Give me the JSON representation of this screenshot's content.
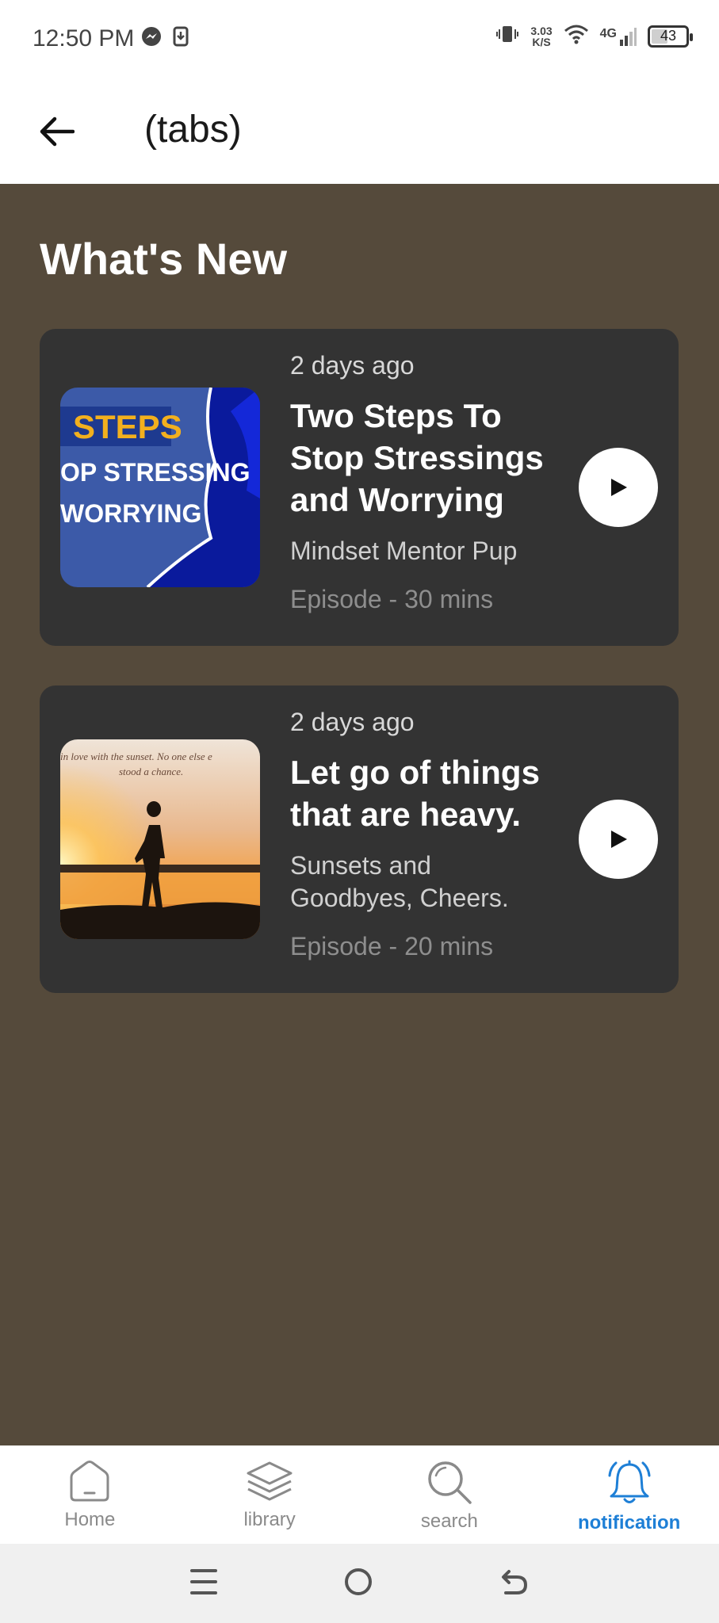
{
  "status_bar": {
    "time": "12:50 PM",
    "net_speed_value": "3.03",
    "net_speed_unit": "K/S",
    "network_type": "4G",
    "battery": "43"
  },
  "app_bar": {
    "title": "(tabs)"
  },
  "section": {
    "title": "What's New"
  },
  "episodes": [
    {
      "posted": "2 days ago",
      "title": "Two Steps To Stop Stressings and Worrying",
      "author": "Mindset Mentor Pup",
      "duration": "Episode - 30 mins",
      "thumb_lines": [
        "STEPS",
        "OP STRESSING",
        "WORRYING"
      ]
    },
    {
      "posted": "2 days ago",
      "title": "Let go of things that are heavy.",
      "author": "Sunsets and Goodbyes, Cheers.",
      "duration": "Episode - 20 mins",
      "thumb_lines": [
        "in love with the sunset. No one else e",
        "stood a chance."
      ]
    }
  ],
  "bottom_nav": [
    {
      "label": "Home",
      "icon": "home-icon",
      "active": false
    },
    {
      "label": "library",
      "icon": "layers-icon",
      "active": false
    },
    {
      "label": "search",
      "icon": "search-icon",
      "active": false
    },
    {
      "label": "notification",
      "icon": "bell-icon",
      "active": true
    }
  ],
  "colors": {
    "content_bg": "#554a3b",
    "card_bg": "#333333",
    "accent": "#1e7fd6"
  }
}
